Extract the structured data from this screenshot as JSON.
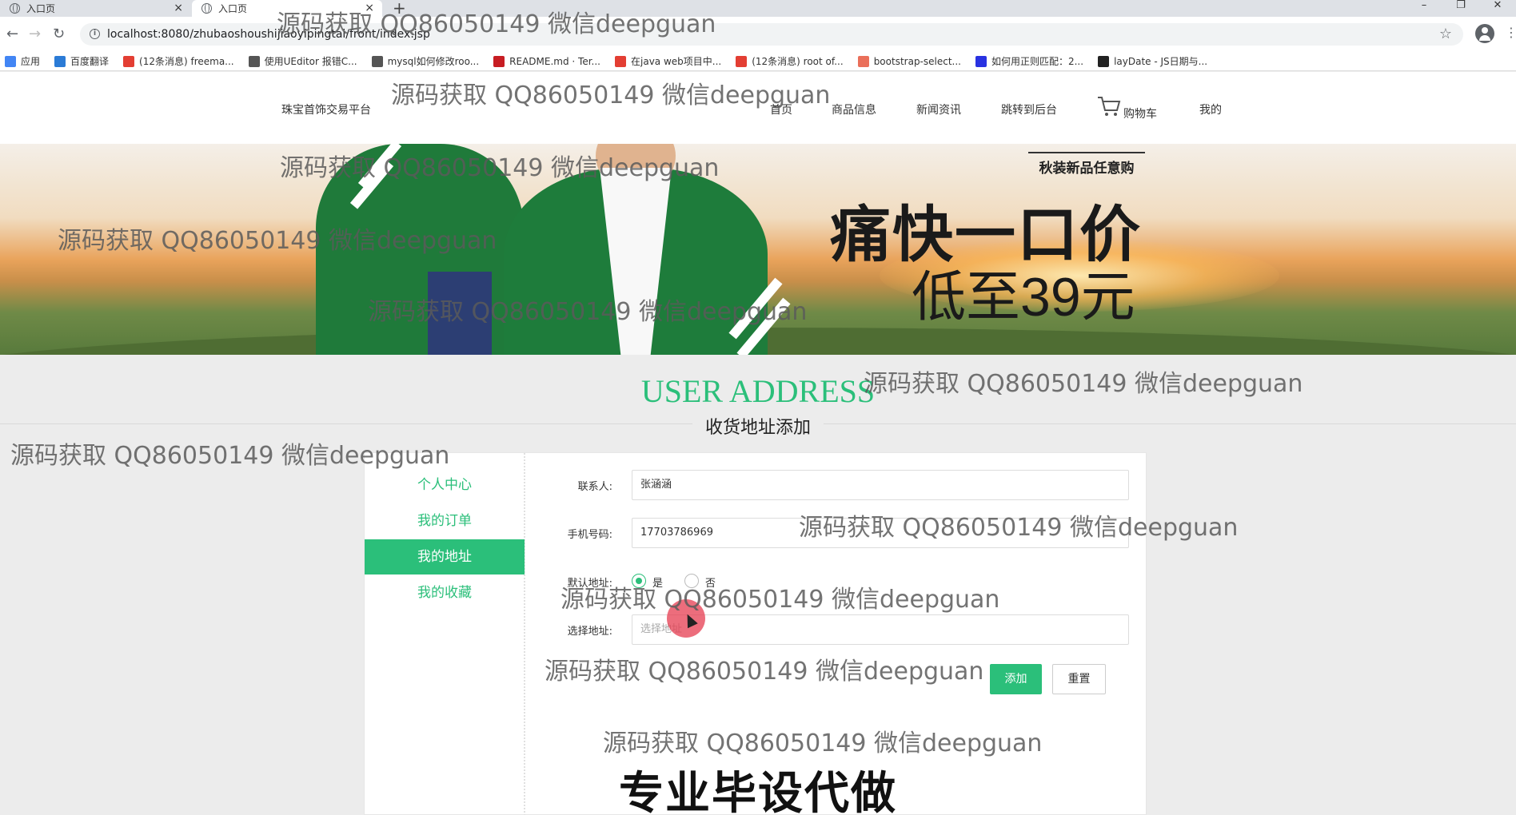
{
  "browser": {
    "tabs": [
      {
        "title": "入口页"
      },
      {
        "title": "入口页"
      }
    ],
    "new_tab": "+",
    "close_glyph": "×",
    "window_buttons": [
      "–",
      "❐",
      "✕"
    ],
    "url": "localhost:8080/zhubaoshoushijiaoyipingtai/front/index.jsp",
    "bookmarks": [
      {
        "label": "应用",
        "icon": "apps-icon",
        "color": "#4285f4"
      },
      {
        "label": "百度翻译",
        "icon": "baidu-translate-icon",
        "color": "#2b7bd6"
      },
      {
        "label": "(12条消息) freema...",
        "icon": "csdn-icon",
        "color": "#e33e33"
      },
      {
        "label": "使用UEditor 报错C...",
        "icon": "link-icon",
        "color": "#555555"
      },
      {
        "label": "mysql如何修改roo...",
        "icon": "link-icon",
        "color": "#555555"
      },
      {
        "label": "README.md · Ter...",
        "icon": "gitee-icon",
        "color": "#c71d23"
      },
      {
        "label": "在java web项目中...",
        "icon": "csdn-icon",
        "color": "#e33e33"
      },
      {
        "label": "(12条消息) root of...",
        "icon": "csdn-icon",
        "color": "#e33e33"
      },
      {
        "label": "bootstrap-select...",
        "icon": "jianshu-icon",
        "color": "#ea6f5a"
      },
      {
        "label": "如何用正则匹配：2...",
        "icon": "baidu-icon",
        "color": "#2932e1"
      },
      {
        "label": "layDate - JS日期与...",
        "icon": "laydate-icon",
        "color": "#222222"
      }
    ]
  },
  "site": {
    "brand": "珠宝首饰交易平台",
    "nav": [
      "首页",
      "商品信息",
      "新闻资讯",
      "跳转到后台",
      "购物车",
      "我的"
    ]
  },
  "banner": {
    "tag": "秋装新品任意购",
    "headline": "痛快一口价",
    "price": "低至39元"
  },
  "section": {
    "title_en": "USER ADDRESS",
    "title_cn": "收货地址添加"
  },
  "sidebar": {
    "items": [
      {
        "label": "个人中心",
        "active": false
      },
      {
        "label": "我的订单",
        "active": false
      },
      {
        "label": "我的地址",
        "active": true
      },
      {
        "label": "我的收藏",
        "active": false
      }
    ]
  },
  "form": {
    "contact_label": "联系人:",
    "contact_value": "张涵涵",
    "phone_label": "手机号码:",
    "phone_value": "17703786969",
    "default_label": "默认地址:",
    "radio_yes": "是",
    "radio_no": "否",
    "default_selected": "是",
    "address_label": "选择地址:",
    "address_placeholder": "选择地址",
    "add_button": "添加",
    "reset_button": "重置"
  },
  "promo": "专业毕设代做",
  "watermark": "源码获取 QQ86050149 微信deepguan",
  "colors": {
    "accent": "#2bbf7a",
    "chrome": "#dee1e6"
  }
}
